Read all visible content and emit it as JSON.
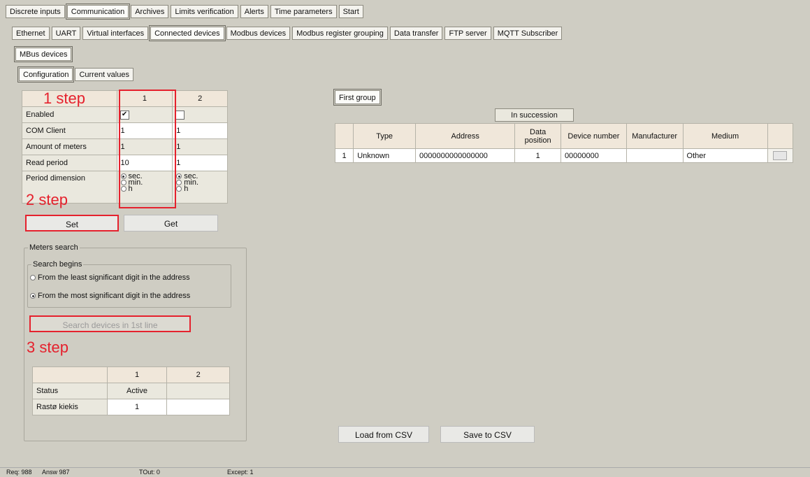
{
  "main_tabs": [
    "Discrete inputs",
    "Communication",
    "Archives",
    "Limits verification",
    "Alerts",
    "Time parameters",
    "Start"
  ],
  "comm_tabs": [
    "Ethernet",
    "UART",
    "Virtual interfaces",
    "Connected devices",
    "Modbus devices",
    "Modbus register grouping",
    "Data transfer",
    "FTP server",
    "MQTT Subscriber"
  ],
  "sub_tab": "MBus devices",
  "config_tabs": [
    "Configuration",
    "Current values"
  ],
  "annotations": {
    "step1": "1 step",
    "step2": "2 step",
    "step3": "3 step"
  },
  "config": {
    "col1": "1",
    "col2": "2",
    "rows": {
      "enabled": "Enabled",
      "com_client": "COM Client",
      "amount": "Amount of meters",
      "read_period": "Read period",
      "period_dim": "Period dimension"
    },
    "values": {
      "com1": "1",
      "com2": "1",
      "amt1": "1",
      "amt2": "1",
      "rp1": "10",
      "rp2": "1"
    },
    "units": {
      "sec": "sec.",
      "min": "min.",
      "h": "h"
    }
  },
  "buttons": {
    "set": "Set",
    "get": "Get",
    "search": "Search devices in 1st line",
    "load": "Load from CSV",
    "save": "Save to CSV"
  },
  "meters_search": {
    "title": "Meters search",
    "begins": "Search begins",
    "opt1": "From the least significant digit in the address",
    "opt2": "From the most significant digit in the address"
  },
  "status_table": {
    "col1": "1",
    "col2": "2",
    "status_label": "Status",
    "status_val": "Active",
    "found_label": "Rastø kiekis",
    "found_val": "1"
  },
  "right": {
    "group_tab": "First group",
    "succession": "In succession",
    "headers": [
      "Type",
      "Address",
      "Data position",
      "Device number",
      "Manufacturer",
      "Medium"
    ],
    "row": {
      "num": "1",
      "type": "Unknown",
      "address": "0000000000000000",
      "data_pos": "1",
      "dev_num": "00000000",
      "manufacturer": "",
      "medium": "Other"
    }
  },
  "statusbar": {
    "req": "Req: 988",
    "answ": "Answ  987",
    "tout": "TOut: 0",
    "except": "Except:  1"
  }
}
